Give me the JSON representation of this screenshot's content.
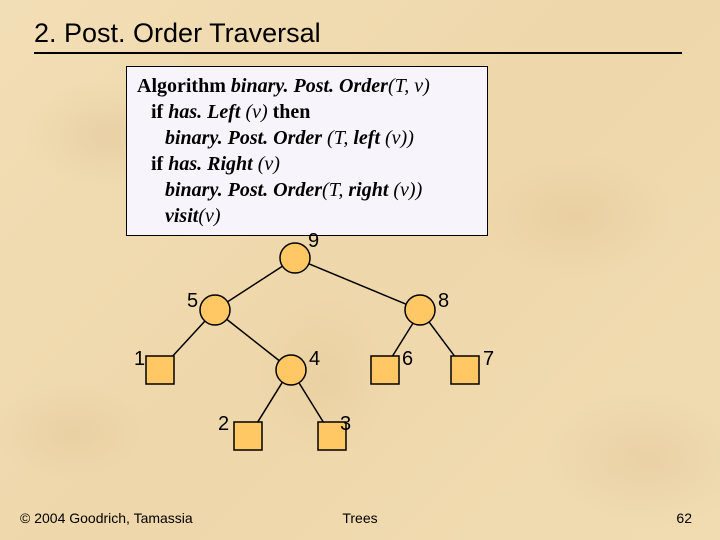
{
  "title": "2. Post. Order Traversal",
  "algorithm": {
    "l1_kw": "Algorithm ",
    "l1_fn": "binary. Post. Order",
    "l1_rest": "(T, v)",
    "l2_kw_if": "if ",
    "l2_fn": "has. Left ",
    "l2_arg": "(v) ",
    "l2_kw_then": "then",
    "l3_fn": "binary. Post. Order ",
    "l3_rest_a": "(T, ",
    "l3_fn2": "left ",
    "l3_rest_b": "(v))",
    "l4_kw_if": "if ",
    "l4_fn": "has. Right ",
    "l4_arg": "(v)",
    "l5_fn": "binary. Post. Order",
    "l5_rest_a": "(T, ",
    "l5_fn2": "right ",
    "l5_rest_b": "(v))",
    "l6_fn": "visit",
    "l6_rest": "(v)"
  },
  "tree": {
    "labels": {
      "root": "9",
      "l": "5",
      "r": "8",
      "ll": "1",
      "lr": "4",
      "rl": "6",
      "rr": "7",
      "lrl": "2",
      "lrr": "3"
    }
  },
  "footer": {
    "left": "© 2004 Goodrich, Tamassia",
    "center": "Trees",
    "right": "62"
  }
}
